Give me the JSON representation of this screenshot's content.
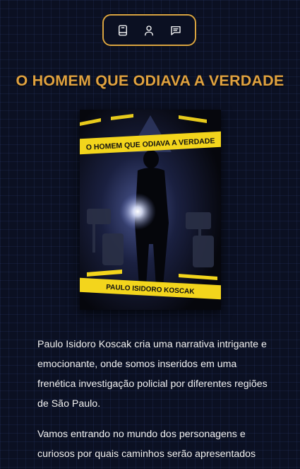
{
  "nav": {
    "items": [
      {
        "name": "book-icon"
      },
      {
        "name": "user-icon"
      },
      {
        "name": "chat-icon"
      }
    ]
  },
  "colors": {
    "accent": "#e0a23f",
    "background": "#0b1022",
    "tape": "#f3d51c"
  },
  "page_title": "O HOMEM QUE ODIAVA A VERDADE",
  "cover": {
    "title": "O HOMEM QUE ODIAVA A VERDADE",
    "author": "PAULO ISIDORO KOSCAK"
  },
  "description": {
    "paragraph1": "Paulo Isidoro Koscak cria uma narrativa intrigante e emocionante, onde somos inseridos em uma frenética investigação policial por diferentes regiões de São Paulo.",
    "paragraph2": "Vamos entrando no mundo dos personagens e curiosos por quais caminhos serão apresentados"
  }
}
